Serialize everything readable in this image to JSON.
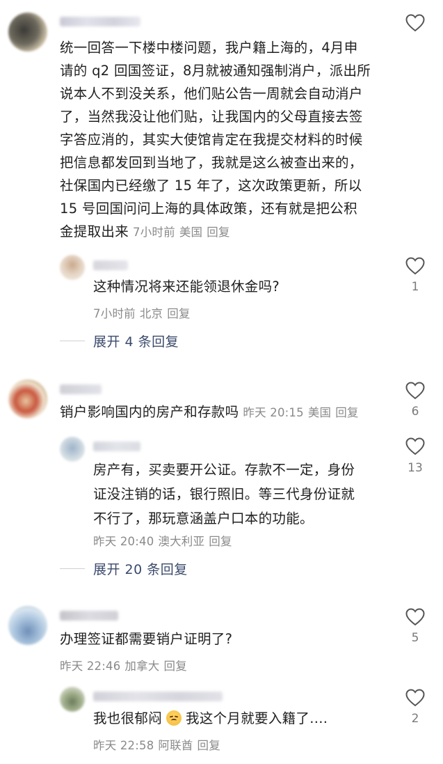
{
  "comments": [
    {
      "text": "统一回答一下楼中楼问题，我户籍上海的，4月申请的q2回国签证，8月就被通知强制消户，派出所说本人不到没关系，他们贴公告一周就会自动消户了，当然我没让他们贴，让我国内的父母直接去签字答应消的，其实大使馆肯定在我提交材料的时候把信息都发回到当地了，我就是这么被查出来的，社保国内已经缴了15年了，这次政策更新，所以15号回国问问上海的具体政策，还有就是把公积金提取出来",
      "lines": [
        "统一回答一下楼中楼问题，我户籍上海的，4月申",
        "请的 q2 回国签证，8月就被通知强制消户，派出所",
        "说本人不到没关系，他们贴公告一周就会自动消户",
        "了，当然我没让他们贴，让我国内的父母直接去签",
        "字答应消的，其实大使馆肯定在我提交材料的时候",
        "把信息都发回到当地了，我就是这么被查出来的，",
        "社保国内已经缴了 15 年了，这次政策更新，所以",
        "15 号回国问问上海的具体政策，还有就是把公积",
        "金提取出来"
      ],
      "time": "7小时前",
      "location": "美国",
      "reply_label": "回复",
      "likes": "",
      "replies": [
        {
          "text": "这种情况将来还能领退休金吗?",
          "time": "7小时前",
          "location": "北京",
          "reply_label": "回复",
          "likes": "1"
        }
      ],
      "expand_label": "展开 4 条回复"
    },
    {
      "text": "销户影响国内的房产和存款吗",
      "time": "昨天 20:15",
      "location": "美国",
      "reply_label": "回复",
      "likes": "6",
      "replies": [
        {
          "lines": [
            "房产有，买卖要开公证。存款不一定，身份",
            "证没注销的话，银行照旧。等三代身份证就",
            "不行了，那玩意涵盖户口本的功能。"
          ],
          "time": "昨天 20:40",
          "location": "澳大利亚",
          "reply_label": "回复",
          "likes": "13"
        }
      ],
      "expand_label": "展开 20 条回复"
    },
    {
      "text": "办理签证都需要销户证明了?",
      "time": "昨天 22:46",
      "location": "加拿大",
      "reply_label": "回复",
      "likes": "5",
      "replies": [
        {
          "text_before": "我也很郁闷",
          "emoji": "unamused-face-emoji",
          "text_after": "我这个月就要入籍了....",
          "time": "昨天 22:58",
          "location": "阿联酋",
          "reply_label": "回复",
          "likes": "2"
        }
      ]
    }
  ],
  "icons": {
    "like": "heart-outline-icon"
  },
  "colors": {
    "text": "#1f1f1f",
    "meta": "#8a8a8a",
    "expand": "#3a4a6b",
    "heart": "#555555"
  }
}
